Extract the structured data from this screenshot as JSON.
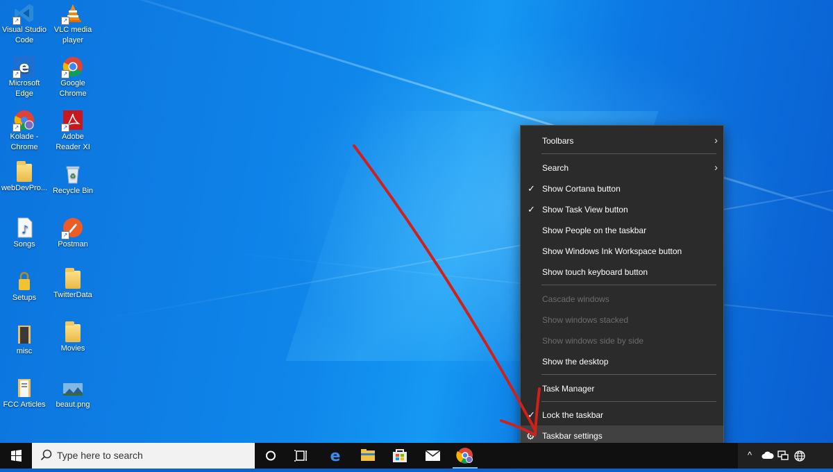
{
  "desktop": {
    "icons": [
      {
        "label_l1": "Visual Studio",
        "label_l2": "Code",
        "icon": "vscode-icon"
      },
      {
        "label_l1": "VLC media",
        "label_l2": "player",
        "icon": "vlc-icon"
      },
      {
        "label_l1": "Microsoft",
        "label_l2": "Edge",
        "icon": "edge-icon"
      },
      {
        "label_l1": "Google",
        "label_l2": "Chrome",
        "icon": "chrome-icon"
      },
      {
        "label_l1": "Kolade -",
        "label_l2": "Chrome",
        "icon": "chrome-profile-icon"
      },
      {
        "label_l1": "Adobe",
        "label_l2": "Reader XI",
        "icon": "adobe-reader-icon"
      },
      {
        "label_l1": "webDevPro...",
        "label_l2": "",
        "icon": "folder-icon"
      },
      {
        "label_l1": "Recycle Bin",
        "label_l2": "",
        "icon": "recycle-bin-icon"
      },
      {
        "label_l1": "Songs",
        "label_l2": "",
        "icon": "music-file-icon"
      },
      {
        "label_l1": "Postman",
        "label_l2": "",
        "icon": "postman-icon"
      },
      {
        "label_l1": "Setups",
        "label_l2": "",
        "icon": "locked-folder-icon"
      },
      {
        "label_l1": "TwitterData",
        "label_l2": "",
        "icon": "folder-icon"
      },
      {
        "label_l1": "misc",
        "label_l2": "",
        "icon": "folder-icon"
      },
      {
        "label_l1": "Movies",
        "label_l2": "",
        "icon": "folder-icon"
      },
      {
        "label_l1": "FCC Articles",
        "label_l2": "",
        "icon": "folder-icon"
      },
      {
        "label_l1": "beaut.png",
        "label_l2": "",
        "icon": "image-file-icon"
      }
    ]
  },
  "context_menu": {
    "items": [
      {
        "label": "Toolbars",
        "checked": false,
        "submenu": true,
        "disabled": false
      },
      {
        "label": "Search",
        "checked": false,
        "submenu": true,
        "disabled": false
      },
      {
        "label": "Show Cortana button",
        "checked": true,
        "disabled": false
      },
      {
        "label": "Show Task View button",
        "checked": true,
        "disabled": false
      },
      {
        "label": "Show People on the taskbar",
        "checked": false,
        "disabled": false
      },
      {
        "label": "Show Windows Ink Workspace button",
        "checked": false,
        "disabled": false
      },
      {
        "label": "Show touch keyboard button",
        "checked": false,
        "disabled": false
      },
      {
        "label": "Cascade windows",
        "checked": false,
        "disabled": true
      },
      {
        "label": "Show windows stacked",
        "checked": false,
        "disabled": true
      },
      {
        "label": "Show windows side by side",
        "checked": false,
        "disabled": true
      },
      {
        "label": "Show the desktop",
        "checked": false,
        "disabled": false
      },
      {
        "label": "Task Manager",
        "checked": false,
        "disabled": false
      },
      {
        "label": "Lock the taskbar",
        "checked": true,
        "disabled": false
      },
      {
        "label": "Taskbar settings",
        "checked": false,
        "disabled": false,
        "highlighted": true,
        "icon": "gear-icon"
      }
    ],
    "check_glyph": "✓",
    "arrow_glyph": "›",
    "gear_glyph": "⚙"
  },
  "taskbar": {
    "search_placeholder": "Type here to search",
    "pinned": [
      "cortana-icon",
      "task-view-icon",
      "edge-icon",
      "file-explorer-icon",
      "microsoft-store-icon",
      "mail-icon",
      "chrome-icon"
    ],
    "tray": {
      "chevron": "^",
      "icons": [
        "onedrive-icon",
        "network-icon",
        "globe-icon"
      ]
    }
  },
  "colors": {
    "menu_bg": "#2b2b2b",
    "menu_hover": "#414141",
    "taskbar_bg": "#101010",
    "annotation_red": "#d0201c"
  }
}
